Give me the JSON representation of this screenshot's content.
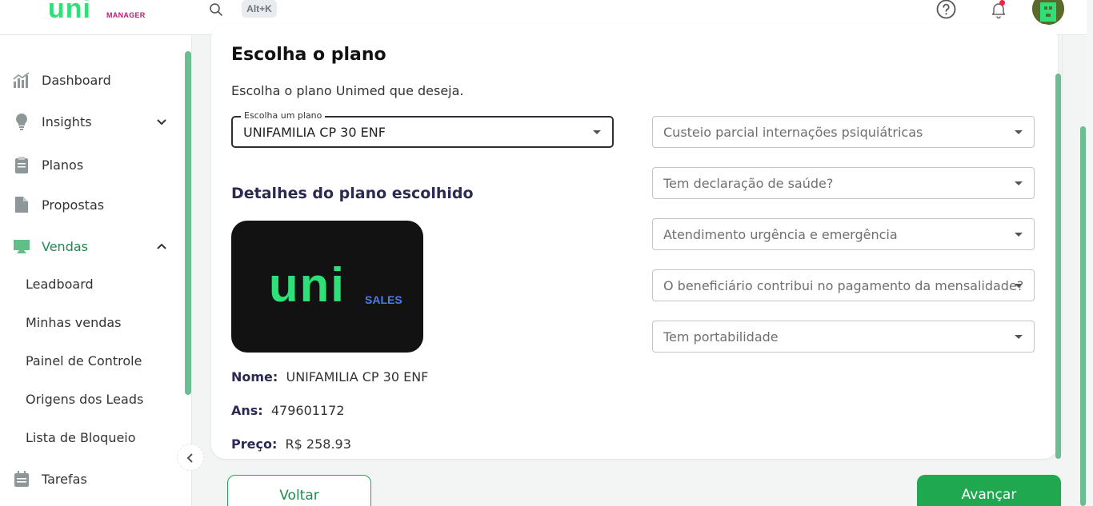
{
  "header": {
    "logo_text": "uni",
    "logo_sub": "MANAGER",
    "shortcut": "Alt+K",
    "icons": [
      "search-icon",
      "help-icon",
      "bell-icon"
    ]
  },
  "sidebar": {
    "items": [
      {
        "label": "Dashboard",
        "icon": "chart-icon"
      },
      {
        "label": "Insights",
        "icon": "lightbulb-icon"
      },
      {
        "label": "Planos",
        "icon": "clipboard-icon"
      },
      {
        "label": "Propostas",
        "icon": "document-icon"
      },
      {
        "label": "Vendas",
        "icon": "monitor-icon"
      },
      {
        "label": "Tarefas",
        "icon": "calendar-icon"
      }
    ],
    "vendas_sub": [
      "Leadboard",
      "Minhas vendas",
      "Painel de Controle",
      "Origens dos Leads",
      "Lista de Bloqueio"
    ]
  },
  "main": {
    "title": "Escolha o plano",
    "subtitle": "Escolha o plano Unimed que deseja.",
    "plan_select": {
      "label": "Escolha um plano",
      "value": "UNIFAMILIA CP 30 ENF"
    },
    "right_selects": [
      "Custeio parcial internações psiquiátricas",
      "Tem declaração de saúde?",
      "Atendimento urgência e emergência",
      "O beneficiário contribui no pagamento da mensalidade?",
      "Tem portabilidade"
    ],
    "details_title": "Detalhes do plano escolhido",
    "plan_logo": {
      "big": "uni",
      "small": "SALES"
    },
    "details": {
      "nome_label": "Nome:",
      "nome": "UNIFAMILIA CP 30 ENF",
      "ans_label": "Ans:",
      "ans": "479601172",
      "preco_label": "Preço:",
      "preco": "R$ 258.93"
    }
  },
  "actions": {
    "back": "Voltar",
    "next": "Avançar"
  },
  "colors": {
    "brand_green": "#2ee078",
    "accent_green": "#1fa84f",
    "heading_navy": "#2b2a52"
  }
}
